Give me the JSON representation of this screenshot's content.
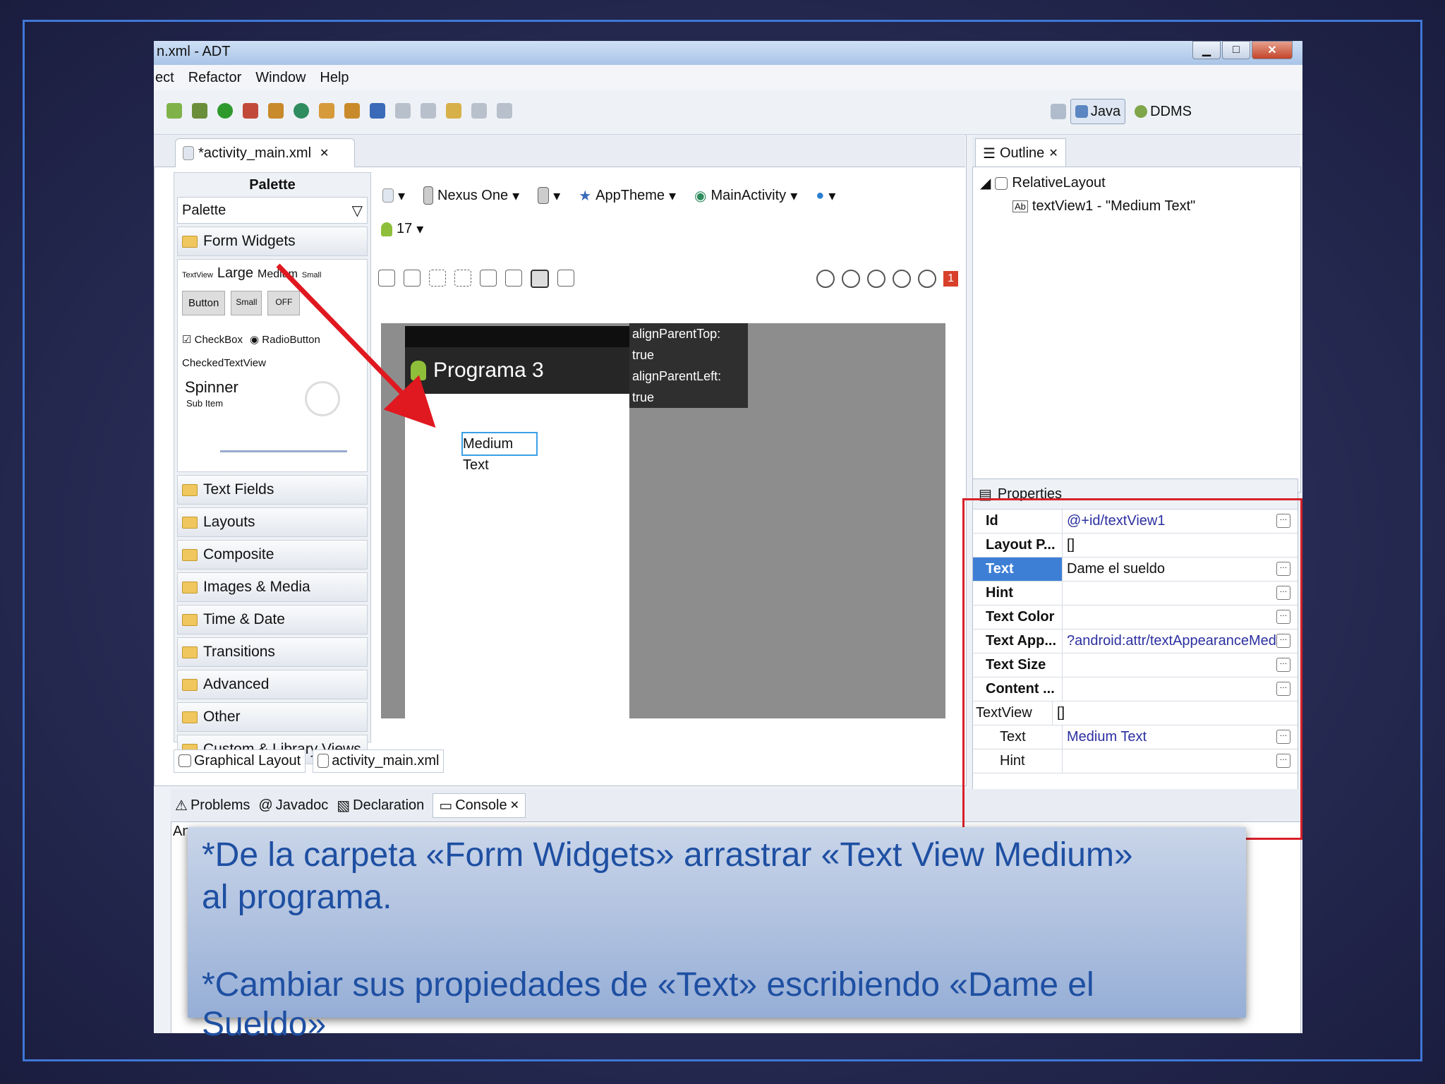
{
  "window": {
    "title": "n.xml - ADT"
  },
  "menu": [
    "ect",
    "Refactor",
    "Window",
    "Help"
  ],
  "perspectives": {
    "java": "Java",
    "ddms": "DDMS"
  },
  "editor_tab": {
    "label": "*activity_main.xml"
  },
  "palette": {
    "header": "Palette",
    "selector": "Palette",
    "open_category": "Form Widgets",
    "widgets": {
      "textview": "TextView",
      "large": "Large",
      "medium": "Medium",
      "small": "Small",
      "button": "Button",
      "small_button": "Small",
      "toggle": "OFF",
      "checkbox": "CheckBox",
      "radio": "RadioButton",
      "checked_text": "CheckedTextView",
      "spinner": "Spinner",
      "sub_item": "Sub Item"
    },
    "categories": [
      "Text Fields",
      "Layouts",
      "Composite",
      "Images & Media",
      "Time & Date",
      "Transitions",
      "Advanced",
      "Other",
      "Custom & Library Views"
    ]
  },
  "canvas_toolbar": {
    "device": "Nexus One",
    "theme": "AppTheme",
    "activity": "MainActivity",
    "api": "17",
    "error_count": "1"
  },
  "device_preview": {
    "app_title": "Programa 3",
    "selected_widget": "Medium Text",
    "tooltip_line1": "alignParentTop: true",
    "tooltip_line2": "alignParentLeft: true"
  },
  "editor_bottom_tabs": [
    "Graphical Layout",
    "activity_main.xml"
  ],
  "outline": {
    "title": "Outline",
    "root": "RelativeLayout",
    "child": "textView1 - \"Medium Text\""
  },
  "properties": {
    "title": "Properties",
    "rows": [
      {
        "key": "Id",
        "value": "@+id/textView1"
      },
      {
        "key": "Layout P...",
        "value": "[]"
      },
      {
        "key": "Text",
        "value": "Dame el sueldo"
      },
      {
        "key": "Hint",
        "value": ""
      },
      {
        "key": "Text Color",
        "value": ""
      },
      {
        "key": "Text App...",
        "value": "?android:attr/textAppearanceMedi..."
      },
      {
        "key": "Text Size",
        "value": ""
      },
      {
        "key": "Content ...",
        "value": ""
      },
      {
        "key": "TextView",
        "value": "[]"
      },
      {
        "key": "Text",
        "value": "Medium Text"
      },
      {
        "key": "Hint",
        "value": ""
      }
    ]
  },
  "console_tabs": [
    "Problems",
    "Javadoc",
    "Declaration",
    "Console"
  ],
  "console_text": "An",
  "caption": {
    "line1": "*De la carpeta «Form Widgets» arrastrar «Text View Medium»",
    "line2": "al programa.",
    "line3": "*Cambiar sus propiedades de «Text» escribiendo «Dame el",
    "line4": "Sueldo»"
  }
}
